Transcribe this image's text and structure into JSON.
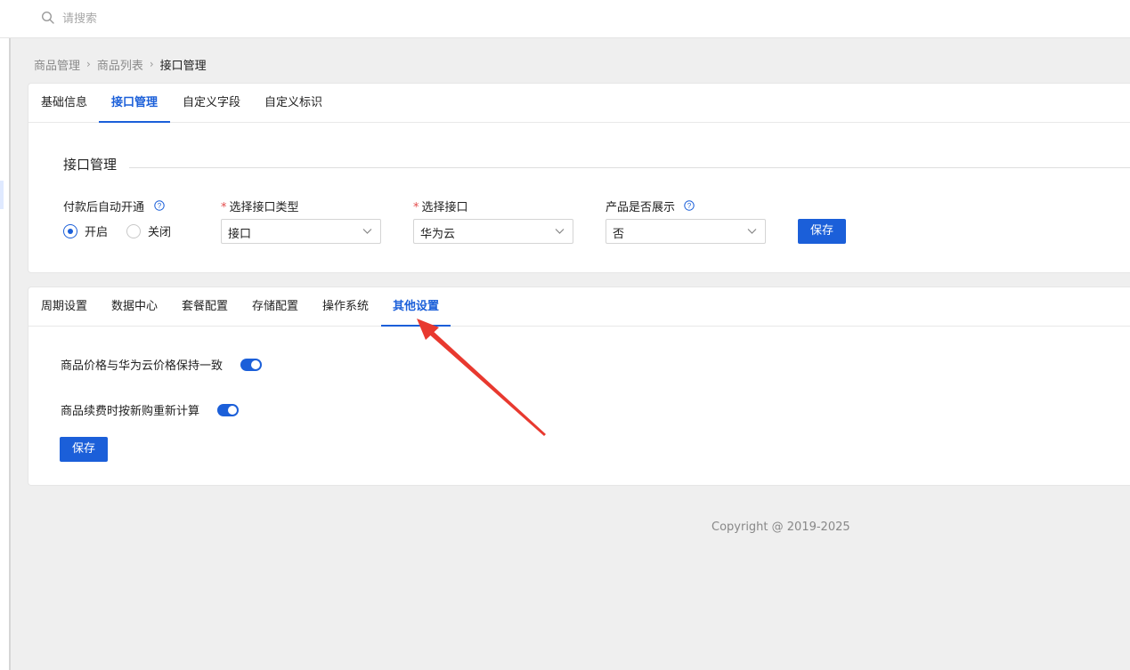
{
  "search": {
    "placeholder": "请搜索"
  },
  "breadcrumb": [
    "商品管理",
    "商品列表",
    "接口管理"
  ],
  "top_tabs": [
    "基础信息",
    "接口管理",
    "自定义字段",
    "自定义标识"
  ],
  "top_tabs_active": "接口管理",
  "interface": {
    "section_title": "接口管理",
    "auto_open": {
      "label": "付款后自动开通",
      "options": [
        "开启",
        "关闭"
      ],
      "selected": "开启"
    },
    "interface_type": {
      "label": "选择接口类型",
      "value": "接口"
    },
    "interface": {
      "label": "选择接口",
      "value": "华为云"
    },
    "display": {
      "label": "产品是否展示",
      "value": "否"
    },
    "save_label": "保存"
  },
  "config_tabs": [
    "周期设置",
    "数据中心",
    "套餐配置",
    "存储配置",
    "操作系统",
    "其他设置"
  ],
  "config_tabs_active": "其他设置",
  "other_settings": {
    "price_sync": {
      "label": "商品价格与华为云价格保持一致",
      "enabled": true
    },
    "renew_recalc": {
      "label": "商品续费时按新购重新计算",
      "enabled": true
    },
    "save_label": "保存"
  },
  "footer": {
    "copyright": "Copyright @ 2019-2025"
  },
  "colors": {
    "primary": "#1b5fd9",
    "required": "#e34b4b",
    "annotation_arrow": "#e8392f"
  }
}
